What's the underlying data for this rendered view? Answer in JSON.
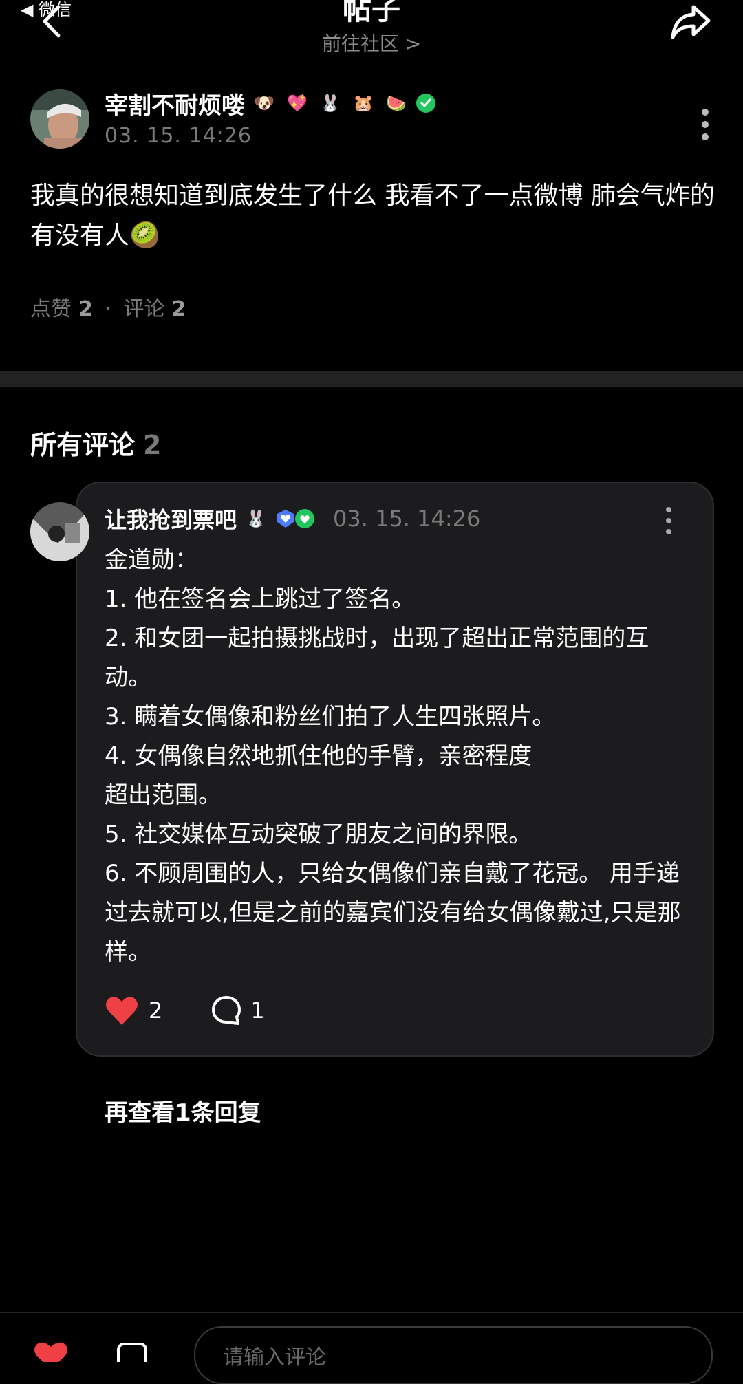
{
  "status": {
    "back_app": "◀ 微信"
  },
  "header": {
    "title": "帖子",
    "community_link": "前往社区 >"
  },
  "post": {
    "author": "宰割不耐烦喽",
    "author_emojis": [
      "🐶",
      "💖",
      "🐰",
      "🐹",
      "🍉"
    ],
    "time": "03. 15. 14:26",
    "body": "我真的很想知道到底发生了什么 我看不了一点微博 肺会气炸的 有没有人🥝",
    "likes_label": "点赞",
    "likes": "2",
    "separator": "·",
    "comments_label": "评论",
    "comments": "2"
  },
  "comments_section": {
    "title": "所有评论",
    "count": "2",
    "items": [
      {
        "author": "让我抢到票吧",
        "author_emoji": "🐰",
        "time": "03. 15. 14:26",
        "body": "金道勋：\n1. 他在签名会上跳过了签名。\n2. 和女团一起拍摄挑战时，出现了超出正常范围的互动。\n3. 瞒着女偶像和粉丝们拍了人生四张照片。\n4. 女偶像自然地抓住他的手臂，亲密程度\n超出范围。\n5. 社交媒体互动突破了朋友之间的界限。\n6. 不顾周围的人，只给女偶像们亲自戴了花冠。 用手递过去就可以,但是之前的嘉宾们没有给女偶像戴过,只是那样。",
        "likes": "2",
        "replies": "1"
      }
    ],
    "more_replies": "再查看1条回复"
  },
  "bottom": {
    "input_placeholder": "请输入评论"
  },
  "colors": {
    "like_red": "#ef4046",
    "verified_green": "#22c55e",
    "verified_blue": "#4f7cff",
    "card_bg": "#1c1c1e"
  }
}
